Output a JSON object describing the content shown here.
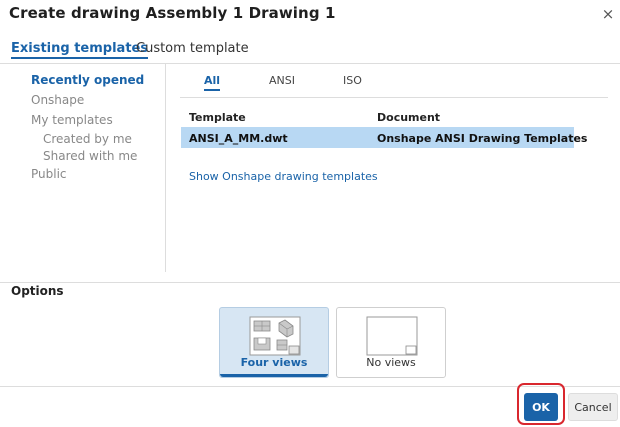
{
  "dialog": {
    "title": "Create drawing Assembly 1 Drawing 1",
    "close_glyph": "×"
  },
  "tabs": {
    "existing": "Existing templates",
    "custom": "Custom template"
  },
  "sidebar": {
    "items": [
      {
        "label": "Recently opened",
        "active": true
      },
      {
        "label": "Onshape"
      },
      {
        "label": "My templates"
      },
      {
        "label": "Created by me"
      },
      {
        "label": "Shared with me"
      },
      {
        "label": "Public"
      }
    ]
  },
  "filters": {
    "all": "All",
    "ansi": "ANSI",
    "iso": "ISO"
  },
  "table": {
    "headers": [
      "Template",
      "Document"
    ],
    "rows": [
      {
        "template": "ANSI_A_MM.dwt",
        "document": "Onshape ANSI Drawing Templates",
        "selected": true
      }
    ]
  },
  "link": {
    "show_templates": "Show Onshape drawing templates"
  },
  "options": {
    "label": "Options",
    "cards": [
      {
        "label": "Four views",
        "icon": "four-views-icon",
        "selected": true
      },
      {
        "label": "No views",
        "icon": "no-views-icon",
        "selected": false
      }
    ]
  },
  "footer": {
    "ok": "OK",
    "cancel": "Cancel"
  },
  "colors": {
    "accent": "#1a63a8",
    "selection": "#b8d8f3",
    "focus_ring": "#d9272e"
  }
}
